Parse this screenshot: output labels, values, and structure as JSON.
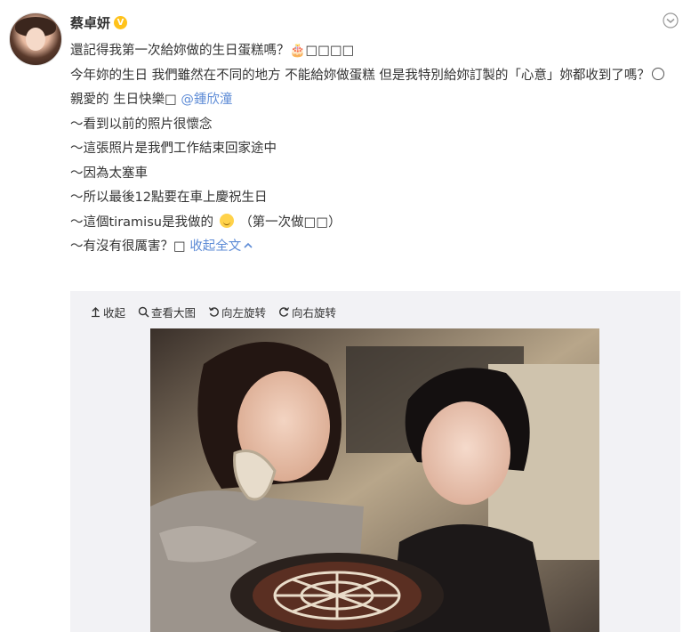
{
  "user": {
    "name": "蔡卓妍",
    "verified_badge": "V"
  },
  "post": {
    "lines": [
      {
        "text": "還記得我第一次給妳做的生日蛋糕嗎？🎂□□□□"
      },
      {
        "text": "今年妳的生日 我們雖然在不同的地方 不能給妳做蛋糕 但是我特別給妳訂製的「心意」妳都收到了嗎？"
      },
      {
        "pre": "親愛的 生日快樂□ ",
        "mention": "@鍾欣潼"
      },
      {
        "text": "～看到以前的照片很懷念"
      },
      {
        "text": "～這張照片是我們工作結束回家途中"
      },
      {
        "text": "～因為太塞車"
      },
      {
        "text": "～所以最後12點要在車上慶祝生日"
      },
      {
        "pre": "～這個tiramisu是我做的 ",
        "post": "（第一次做□□）"
      },
      {
        "pre": "～有沒有很厲害？□ ",
        "collapse": "收起全文"
      }
    ]
  },
  "media_toolbar": {
    "collapse": "收起",
    "view_large": "查看大图",
    "rotate_left": "向左旋转",
    "rotate_right": "向右旋转"
  },
  "colors": {
    "link": "#eb7350",
    "mention": "#5d8bd6",
    "badge": "#ffc21a",
    "media_bg": "#f2f2f5"
  },
  "icons": {
    "more": "chevron-down-icon",
    "collapse": "arrow-up-icon",
    "view_large": "search-icon",
    "rotate_left": "rotate-left-icon",
    "rotate_right": "rotate-right-icon"
  }
}
